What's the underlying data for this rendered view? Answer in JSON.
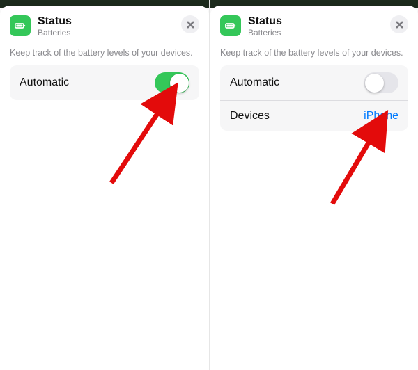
{
  "left": {
    "title": "Status",
    "subtitle": "Batteries",
    "description": "Keep track of the battery levels of your devices.",
    "rows": {
      "automatic": {
        "label": "Automatic",
        "on": true
      }
    }
  },
  "right": {
    "title": "Status",
    "subtitle": "Batteries",
    "description": "Keep track of the battery levels of your devices.",
    "rows": {
      "automatic": {
        "label": "Automatic",
        "on": false
      },
      "devices": {
        "label": "Devices",
        "value": "iPhone"
      }
    }
  },
  "colors": {
    "accent_green": "#34c759",
    "link_blue": "#007aff"
  }
}
